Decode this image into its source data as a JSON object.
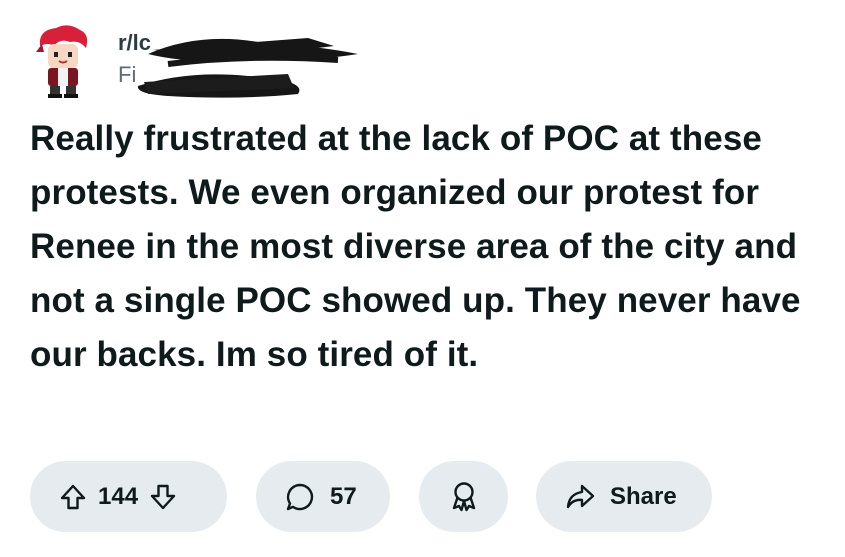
{
  "post": {
    "subreddit": "r/lc",
    "username": "Fi",
    "body": "Really frustrated at the lack of POC at these protests. We even organized our protest for Renee in the most diverse area of the city and not a single POC showed up. They never have our backs. Im so tired of it."
  },
  "actions": {
    "vote_count": "144",
    "comment_count": "57",
    "share_label": "Share"
  },
  "icons": {
    "upvote": "upvote-arrow-icon",
    "downvote": "downvote-arrow-icon",
    "comment": "comment-bubble-icon",
    "award": "award-ribbon-icon",
    "share": "share-arrow-icon"
  },
  "colors": {
    "pill_background": "#e5ebee",
    "text": "#0f1a1c",
    "avatar_hair": "#d8203a"
  }
}
